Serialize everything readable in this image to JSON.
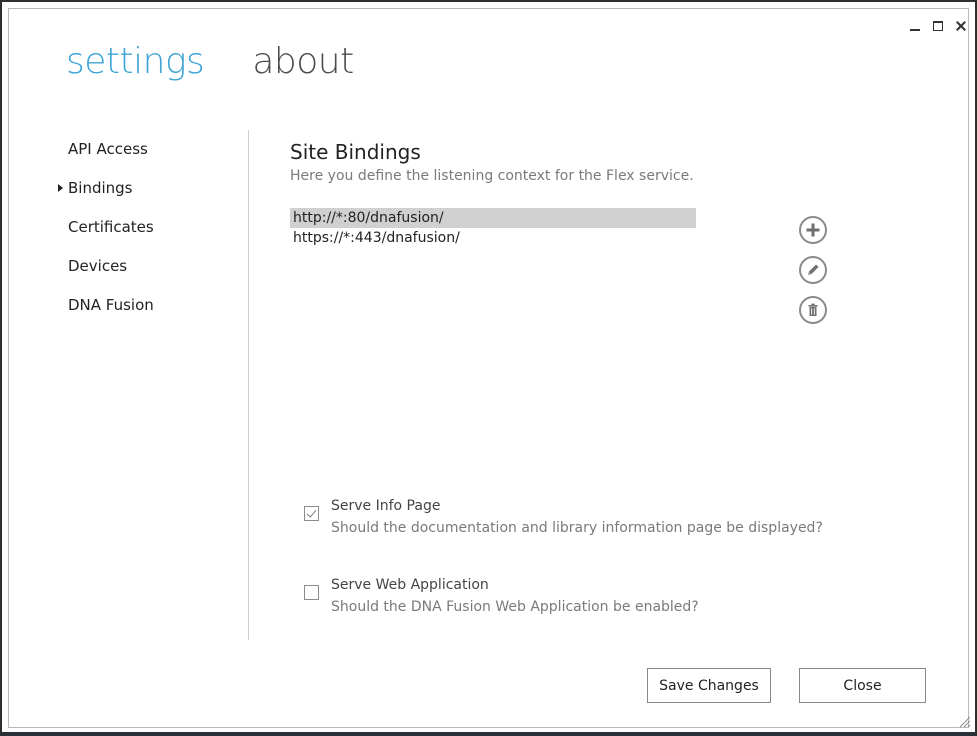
{
  "window": {
    "controls": {
      "minimize_icon": "minimize-icon",
      "maximize_icon": "maximize-icon",
      "close_icon": "close-icon"
    }
  },
  "pivot": {
    "items": [
      {
        "label": "settings",
        "active": true
      },
      {
        "label": "about",
        "active": false
      }
    ]
  },
  "sidebar": {
    "items": [
      {
        "label": "API Access",
        "selected": false
      },
      {
        "label": "Bindings",
        "selected": true
      },
      {
        "label": "Certificates",
        "selected": false
      },
      {
        "label": "Devices",
        "selected": false
      },
      {
        "label": "DNA Fusion",
        "selected": false
      }
    ]
  },
  "main": {
    "title": "Site Bindings",
    "description": "Here you define the listening context for the Flex service.",
    "bindings": [
      {
        "url": "http://*:80/dnafusion/",
        "selected": true
      },
      {
        "url": "https://*:443/dnafusion/",
        "selected": false
      }
    ],
    "actions": {
      "add_icon": "plus-circle-icon",
      "edit_icon": "pencil-circle-icon",
      "delete_icon": "trash-circle-icon"
    },
    "options": [
      {
        "title": "Serve Info Page",
        "description": "Should the documentation and library information page be displayed?",
        "checked": true
      },
      {
        "title": "Serve Web Application",
        "description": "Should the DNA Fusion Web Application be enabled?",
        "checked": false
      }
    ]
  },
  "footer": {
    "save_label": "Save Changes",
    "close_label": "Close"
  },
  "colors": {
    "accent": "#3fa4d6",
    "selection": "#d0d0d0"
  }
}
